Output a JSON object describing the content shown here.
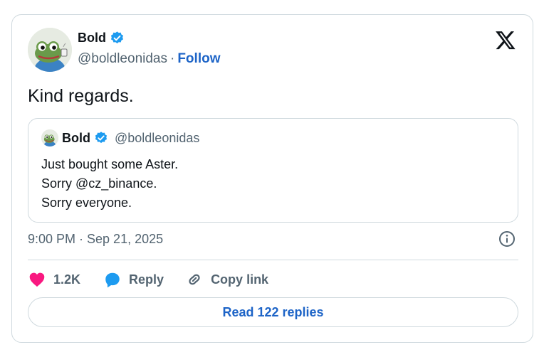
{
  "author": {
    "name": "Bold",
    "handle": "@boldleonidas",
    "separator": "·",
    "follow_label": "Follow"
  },
  "tweet": {
    "text": "Kind regards."
  },
  "quote": {
    "name": "Bold",
    "handle": "@boldleonidas",
    "lines": [
      "Just bought some Aster.",
      "Sorry @cz_binance.",
      "Sorry everyone."
    ]
  },
  "timestamp": "9:00 PM · Sep 21, 2025",
  "actions": {
    "likes": "1.2K",
    "reply_label": "Reply",
    "copy_link_label": "Copy link"
  },
  "read_replies_label": "Read 122 replies",
  "colors": {
    "accent": "#1d64c7",
    "verified": "#1d9bf0",
    "heart": "#f91880",
    "reply_bubble": "#1d9bf0",
    "muted_text": "#536471",
    "border": "#cfd9de"
  },
  "icons": {
    "x_logo": "x-logo-icon",
    "verified": "verified-badge-icon",
    "info": "info-icon",
    "heart": "heart-icon",
    "reply": "speech-bubble-icon",
    "link": "link-icon"
  }
}
